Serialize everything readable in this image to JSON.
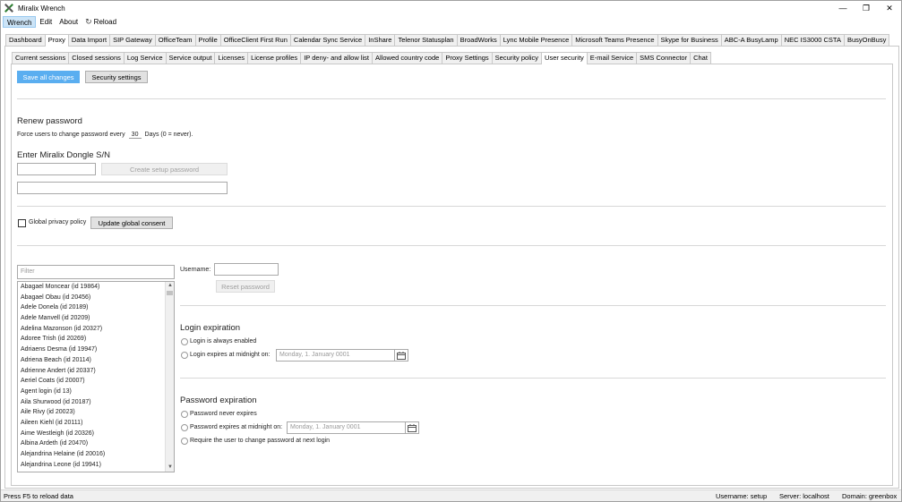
{
  "window": {
    "title": "Miralix Wrench"
  },
  "menu": {
    "items": [
      "Wrench",
      "Edit",
      "About"
    ],
    "reload_label": "Reload"
  },
  "top_tabs": [
    "Dashboard",
    "Proxy",
    "Data Import",
    "SIP Gateway",
    "OfficeTeam",
    "Profile",
    "OfficeClient First Run",
    "Calendar Sync Service",
    "InShare",
    "Telenor Statusplan",
    "BroadWorks",
    "Lync Mobile Presence",
    "Microsoft Teams Presence",
    "Skype for Business",
    "ABC-A BusyLamp",
    "NEC IS3000 CSTA",
    "BusyOnBusy"
  ],
  "top_tab_selected": "Proxy",
  "sub_tabs": [
    "Current sessions",
    "Closed sessions",
    "Log Service",
    "Service output",
    "Licenses",
    "License profiles",
    "IP deny- and allow list",
    "Allowed country code",
    "Proxy Settings",
    "Security policy",
    "User security",
    "E-mail Service",
    "SMS Connector",
    "Chat"
  ],
  "sub_tab_selected": "User security",
  "toolbar": {
    "save_all": "Save all changes",
    "security_settings": "Security settings"
  },
  "renew": {
    "heading": "Renew password",
    "prefix": "Force users to change password every",
    "days": "30",
    "suffix": "Days (0 = never)."
  },
  "dongle": {
    "heading": "Enter Miralix Dongle S/N",
    "create_button": "Create setup password"
  },
  "privacy": {
    "checkbox_label": "Global privacy policy",
    "update_button": "Update global consent"
  },
  "filter": {
    "placeholder": "Filter"
  },
  "users": [
    "Abagael Moncear (id 19864)",
    "Abagael Obau (id 20456)",
    "Adele Donela (id 20189)",
    "Adele Manvell (id 20209)",
    "Adelina Mazonson (id 20327)",
    "Adoree Trish (id 20269)",
    "Adriaens Desma (id 19947)",
    "Adriena Beach (id 20114)",
    "Adrienne Andert (id 20337)",
    "Aeriel Coats (id 20007)",
    "Agent login (id 13)",
    "Aila Shurwood (id 20187)",
    "Aile Rivy (id 20023)",
    "Aileen Kiehl (id 20111)",
    "Aime Westleigh (id 20326)",
    "Albina Ardeth (id 20470)",
    "Alejandrina Helaine (id 20016)",
    "Alejandrina Leone (id 19941)"
  ],
  "user_detail": {
    "username_label": "Username:",
    "reset_button": "Reset password"
  },
  "login_expiration": {
    "heading": "Login expiration",
    "always": "Login is always enabled",
    "expires": "Login expires at midnight on:",
    "date": "Monday, 1. January 0001"
  },
  "password_expiration": {
    "heading": "Password expiration",
    "never": "Password never expires",
    "expires": "Password expires at midnight on:",
    "date": "Monday, 1. January 0001",
    "require_change": "Require the user to change password at next login"
  },
  "status": {
    "left": "Press F5 to reload data",
    "username": "Username: setup",
    "server": "Server: localhost",
    "domain": "Domain: greenbox"
  }
}
